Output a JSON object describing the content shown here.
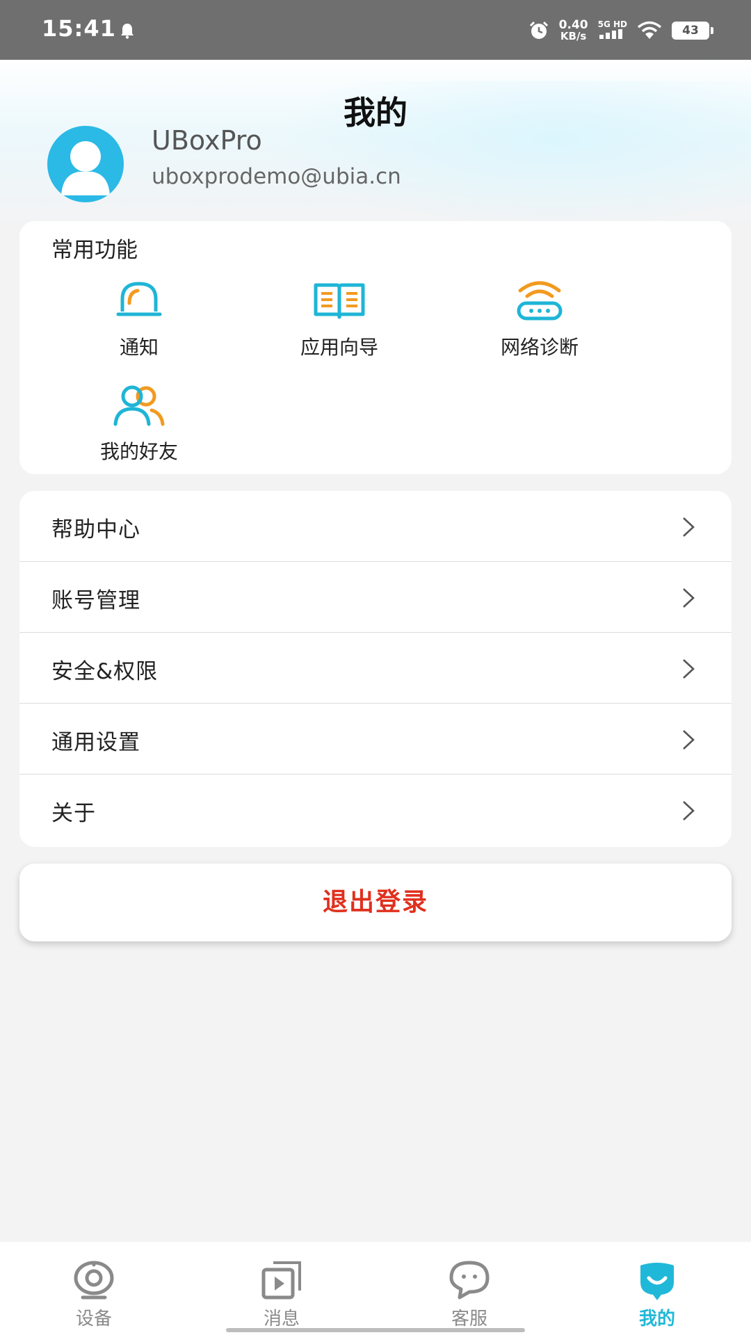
{
  "status_bar": {
    "time": "15:41",
    "speed_value": "0.40",
    "speed_unit": "KB/s",
    "network_type": "5G HD",
    "battery": "43"
  },
  "header": {
    "title": "我的",
    "username": "UBoxPro",
    "email": "uboxprodemo@ubia.cn"
  },
  "common_functions": {
    "title": "常用功能",
    "items": [
      {
        "label": "通知",
        "icon": "bell-icon"
      },
      {
        "label": "应用向导",
        "icon": "book-icon"
      },
      {
        "label": "网络诊断",
        "icon": "router-wifi-icon"
      },
      {
        "label": "我的好友",
        "icon": "friends-icon"
      }
    ]
  },
  "menu": {
    "items": [
      {
        "label": "帮助中心"
      },
      {
        "label": "账号管理"
      },
      {
        "label": "安全&权限"
      },
      {
        "label": "通用设置"
      },
      {
        "label": "关于"
      }
    ]
  },
  "logout_label": "退出登录",
  "tabbar": {
    "items": [
      {
        "label": "设备",
        "icon": "camera-icon",
        "active": false
      },
      {
        "label": "消息",
        "icon": "message-video-icon",
        "active": false
      },
      {
        "label": "客服",
        "icon": "chat-bubble-icon",
        "active": false
      },
      {
        "label": "我的",
        "icon": "me-face-icon",
        "active": true
      }
    ]
  },
  "colors": {
    "accent": "#20b8d8",
    "logout_red": "#e0301e",
    "icon_orange": "#f29a1f"
  }
}
